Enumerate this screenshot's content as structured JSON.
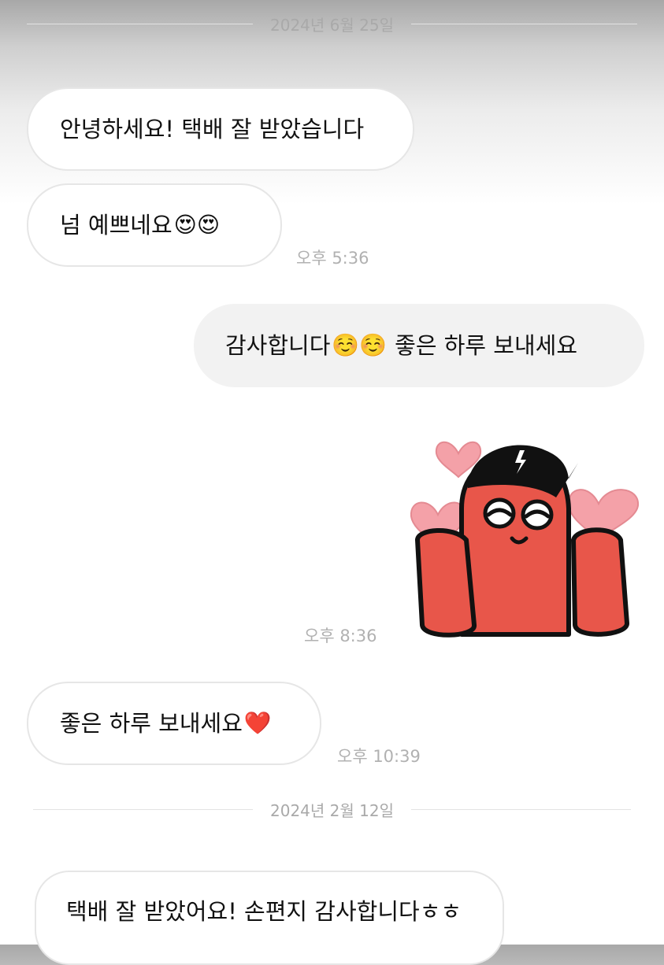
{
  "chat": {
    "date1": "2024년 6월 25일",
    "msg1": "안녕하세요! 택배 잘 받았습니다",
    "msg2": "넘 예쁘네요",
    "msg2_emojis": "😍😍",
    "time1": "오후 5:36",
    "msg3": "감사합니다",
    "msg3_emojis": "☺️☺️",
    "msg3_tail": "좋은 하루 보내세요",
    "sticker": "sticker-red-character-with-hearts",
    "time2": "오후 8:36",
    "msg4": "좋은 하루 보내세요",
    "msg4_emoji": "❤️",
    "time3": "오후 10:39",
    "date2": "2024년 2월 12일",
    "msg5": "택배 잘 받았어요! 손편지 감사합니다ㅎㅎ"
  },
  "colors": {
    "incoming_bubble": "#ffffff",
    "outgoing_bubble": "#f2f2f2",
    "sticker_red": "#e8564a",
    "sticker_heart": "#f4a1a8"
  }
}
